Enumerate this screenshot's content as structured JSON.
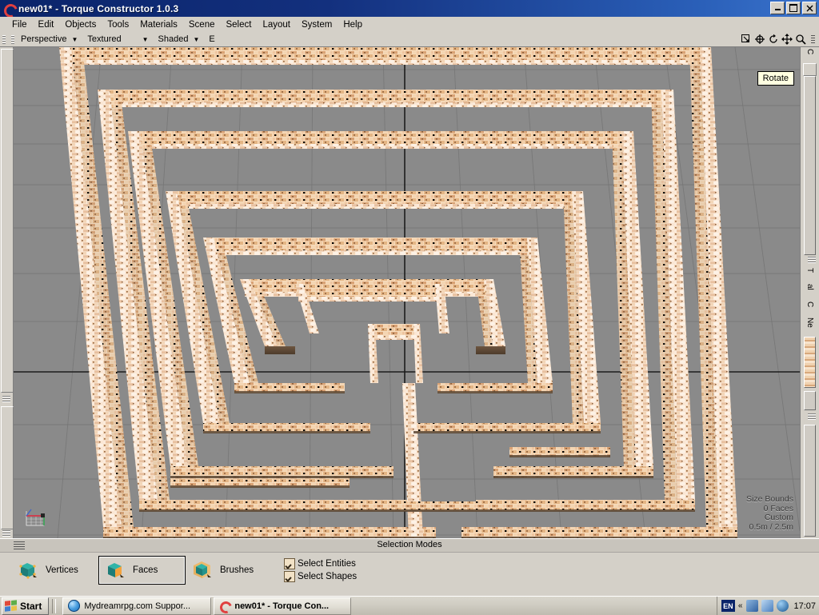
{
  "window": {
    "title": "new01* - Torque Constructor 1.0.3",
    "icon": "torque-spiral-icon",
    "minimize_label": "_",
    "maximize_label": "❑",
    "close_label": "✕"
  },
  "menubar": {
    "items": [
      {
        "label": "File"
      },
      {
        "label": "Edit"
      },
      {
        "label": "Objects"
      },
      {
        "label": "Tools"
      },
      {
        "label": "Materials"
      },
      {
        "label": "Scene"
      },
      {
        "label": "Select"
      },
      {
        "label": "Layout"
      },
      {
        "label": "System"
      },
      {
        "label": "Help"
      }
    ]
  },
  "toolbar": {
    "view_mode": "Perspective",
    "render_mode": "Textured",
    "shading_mode": "Shaded",
    "extra_label": "E",
    "dropdown_arrow": "▼",
    "right_icons": [
      {
        "name": "select-box-icon"
      },
      {
        "name": "scale-icon"
      },
      {
        "name": "rotate-icon"
      },
      {
        "name": "move-icon"
      },
      {
        "name": "zoom-icon"
      }
    ]
  },
  "viewport": {
    "tooltip": "Rotate",
    "background_color": "#8a8a8a",
    "grid_color": "#6f6f6f",
    "axis_color": "#1c1c1c",
    "wall_color": "#f2d4b4",
    "stats": {
      "line1": "Size Bounds",
      "line2": "0 Faces",
      "line3": "Custom",
      "line4": "0.5m / 2.5m"
    }
  },
  "dock": {
    "right_labels": [
      "C",
      "T",
      "al",
      "C",
      "Ne"
    ]
  },
  "selection_panel": {
    "title": "Selection Modes",
    "modes": [
      {
        "label": "Vertices",
        "active": false,
        "icon": "cube-vertices-icon"
      },
      {
        "label": "Faces",
        "active": true,
        "icon": "cube-faces-icon"
      },
      {
        "label": "Brushes",
        "active": false,
        "icon": "cube-brushes-icon"
      }
    ],
    "checkboxes": [
      {
        "label": "Select Entities",
        "checked": true
      },
      {
        "label": "Select Shapes",
        "checked": true
      }
    ]
  },
  "taskbar": {
    "start_label": "Start",
    "items": [
      {
        "label": "Mydreamrpg.com Suppor...",
        "icon": "ie-icon",
        "active": false
      },
      {
        "label": "new01* - Torque Con...",
        "icon": "torque-spiral-icon",
        "active": true
      }
    ],
    "tray": {
      "language": "EN",
      "chevron": "«",
      "icons": [
        {
          "name": "network-icon",
          "color": "#4f7fc0"
        },
        {
          "name": "display-icon",
          "color": "#6ea2d8"
        },
        {
          "name": "audio-icon",
          "color": "#2f6fa8"
        }
      ],
      "clock": "17:07"
    }
  },
  "maze": {
    "description": "Concentric square labyrinth of textured brick walls viewed in perspective",
    "ring_count": 7
  }
}
